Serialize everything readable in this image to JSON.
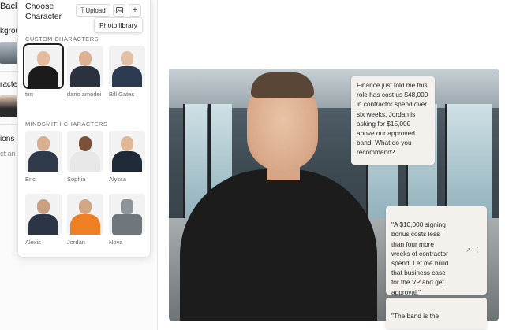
{
  "left_panel": {
    "back_label": "Back",
    "background_label": "kgrou",
    "character_label": "racte",
    "options_label": "ions",
    "options_hint": "ct an o"
  },
  "chooser": {
    "title": "Choose Character",
    "upload_label": "Upload",
    "tooltip": "Photo library",
    "custom_label": "CUSTOM CHARACTERS",
    "custom": [
      {
        "name": "tim"
      },
      {
        "name": "dario amodei"
      },
      {
        "name": "Bill Gates"
      }
    ],
    "mindsmith_label": "MINDSMITH CHARACTERS",
    "mindsmith": [
      {
        "name": "Eric"
      },
      {
        "name": "Sophia"
      },
      {
        "name": "Alyssa"
      },
      {
        "name": "Alexis"
      },
      {
        "name": "Jordan"
      },
      {
        "name": "Nova"
      }
    ]
  },
  "scene": {
    "user_message": "Finance just told me this role has cost us $48,000 in contractor spend over six weeks. Jordan is asking for $15,000 above our approved band. What do you recommend?",
    "bot_message": "\"A $10,000 signing bonus costs less than four more weeks of contractor spend. Let me build that business case for the VP and get approval.\"",
    "bot_message_2": "\"The band is the"
  },
  "icons": {
    "upload": "upload-icon",
    "photo": "image-icon",
    "add": "plus-icon",
    "edit": "external-edit-icon",
    "drag": "drag-handle-icon"
  }
}
